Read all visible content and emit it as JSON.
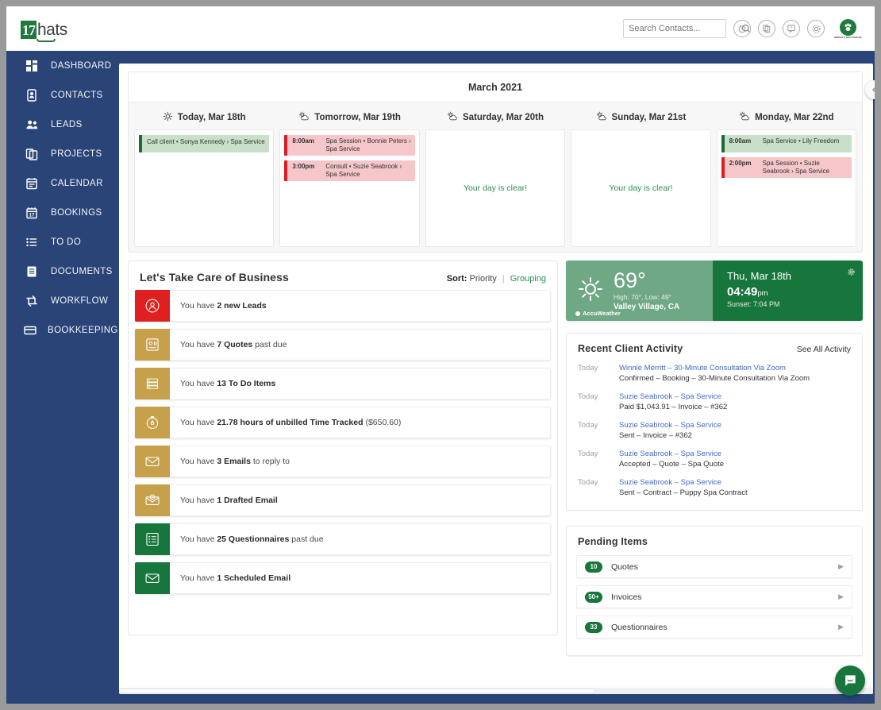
{
  "app": {
    "logo_mark": "17",
    "logo_text": "hats",
    "brand_text": "BRIDGE'S DOG PAWLOR"
  },
  "search": {
    "placeholder": "Search Contacts...",
    "value": ""
  },
  "header_icons": [
    {
      "name": "alarm-icon",
      "glyph": "⏰"
    },
    {
      "name": "copy-docs-icon",
      "glyph": "❐"
    },
    {
      "name": "help-icon",
      "glyph": "?"
    },
    {
      "name": "gear-icon",
      "glyph": "⚙"
    }
  ],
  "sidebar": {
    "items": [
      {
        "label": "DASHBOARD",
        "icon": "grid-icon"
      },
      {
        "label": "CONTACTS",
        "icon": "contact-card-icon"
      },
      {
        "label": "LEADS",
        "icon": "people-icon"
      },
      {
        "label": "PROJECTS",
        "icon": "copy-pages-icon"
      },
      {
        "label": "CALENDAR",
        "icon": "calendar-icon"
      },
      {
        "label": "BOOKINGS",
        "icon": "calendar-17-icon"
      },
      {
        "label": "TO DO",
        "icon": "list-icon"
      },
      {
        "label": "DOCUMENTS",
        "icon": "document-icon"
      },
      {
        "label": "WORKFLOW",
        "icon": "workflow-arrows-icon"
      },
      {
        "label": "BOOKKEEPING",
        "icon": "card-icon"
      }
    ]
  },
  "calendar": {
    "month_title": "March 2021",
    "days": [
      {
        "weather_icon": "sun-icon",
        "label": "Today, Mar 18th",
        "clear_message": "",
        "events": [
          {
            "time": "",
            "title": "Call client • Sonya Kennedy › Spa Service",
            "color": "green"
          }
        ]
      },
      {
        "weather_icon": "sun-cloud-icon",
        "label": "Tomorrow, Mar 19th",
        "clear_message": "",
        "events": [
          {
            "time": "8:00am",
            "title": "Spa Session • Bonnie Peters › Spa Service",
            "color": "red"
          },
          {
            "time": "3:00pm",
            "title": "Consult • Suzie Seabrook › Spa Service",
            "color": "red"
          }
        ]
      },
      {
        "weather_icon": "sun-cloud-icon",
        "label": "Saturday, Mar 20th",
        "clear_message": "Your day is clear!",
        "events": []
      },
      {
        "weather_icon": "sun-cloud-icon",
        "label": "Sunday, Mar 21st",
        "clear_message": "Your day is clear!",
        "events": []
      },
      {
        "weather_icon": "sun-cloud-icon",
        "label": "Monday, Mar 22nd",
        "clear_message": "",
        "events": [
          {
            "time": "8:00am",
            "title": "Spa Service • Lily Freedom",
            "color": "green"
          },
          {
            "time": "2:00pm",
            "title": "Spa Session • Suzie Seabrook › Spa Service",
            "color": "red"
          }
        ]
      }
    ]
  },
  "business": {
    "title": "Let's Take Care of Business",
    "sort_label": "Sort:",
    "sort_value": "Priority",
    "separator": "|",
    "grouping_label": "Grouping",
    "items": [
      {
        "icon": "lead-person-icon",
        "color": "red",
        "pre": "You have ",
        "strong": "2 new Leads",
        "post": ""
      },
      {
        "icon": "quote-icon",
        "color": "gold",
        "pre": "You have ",
        "strong": "7 Quotes",
        "post": " past due"
      },
      {
        "icon": "todo-list-icon",
        "color": "gold",
        "pre": "You have ",
        "strong": "13 To Do Items",
        "post": ""
      },
      {
        "icon": "timer-icon",
        "color": "gold",
        "pre": "You have ",
        "strong": "21.78 hours of unbilled Time Tracked",
        "post": " ($650.60)"
      },
      {
        "icon": "envelope-icon",
        "color": "gold",
        "pre": "You have ",
        "strong": "3 Emails",
        "post": " to reply to"
      },
      {
        "icon": "draft-email-icon",
        "color": "gold",
        "pre": "You have ",
        "strong": "1 Drafted Email",
        "post": ""
      },
      {
        "icon": "questionnaire-icon",
        "color": "green",
        "pre": "You have ",
        "strong": "25 Questionnaires",
        "post": " past due"
      },
      {
        "icon": "envelope-icon",
        "color": "green",
        "pre": "You have ",
        "strong": "1 Scheduled Email",
        "post": ""
      }
    ]
  },
  "weather": {
    "icon": "sun-icon",
    "temp": "69°",
    "highlow": "High: 70°, Low: 49°",
    "location": "Valley Village, CA",
    "provider": "AccuWeather",
    "date": "Thu, Mar 18th",
    "time": "04:49",
    "time_meridiem": "pm",
    "sunset": "Sunset: 7:04 PM"
  },
  "activity": {
    "title": "Recent Client Activity",
    "link": "See All Activity",
    "rows": [
      {
        "day": "Today",
        "title": "Winnie Merritt  –  30-Minute Consultation Via Zoom",
        "desc": "Confirmed  –  Booking  –  30-Minute Consultation Via Zoom"
      },
      {
        "day": "Today",
        "title": "Suzie Seabrook  –  Spa Service",
        "desc": "Paid $1,043.91  –  Invoice  –  #362"
      },
      {
        "day": "Today",
        "title": "Suzie Seabrook  –  Spa Service",
        "desc": "Sent  –  Invoice  –  #362"
      },
      {
        "day": "Today",
        "title": "Suzie Seabrook  –  Spa Service",
        "desc": "Accepted  –  Quote  –  Spa Quote"
      },
      {
        "day": "Today",
        "title": "Suzie Seabrook  –  Spa Service",
        "desc": "Sent  –  Contract  –  Puppy Spa Contract"
      }
    ]
  },
  "pending": {
    "title": "Pending Items",
    "rows": [
      {
        "count": "10",
        "label": "Quotes"
      },
      {
        "count": "50+",
        "label": "Invoices"
      },
      {
        "count": "33",
        "label": "Questionnaires"
      }
    ]
  },
  "colors": {
    "sidebar": "#2a4478",
    "brand_green": "#17763b",
    "accent_red": "#e02020",
    "accent_gold": "#c6a04a",
    "link_blue": "#4169c9"
  }
}
